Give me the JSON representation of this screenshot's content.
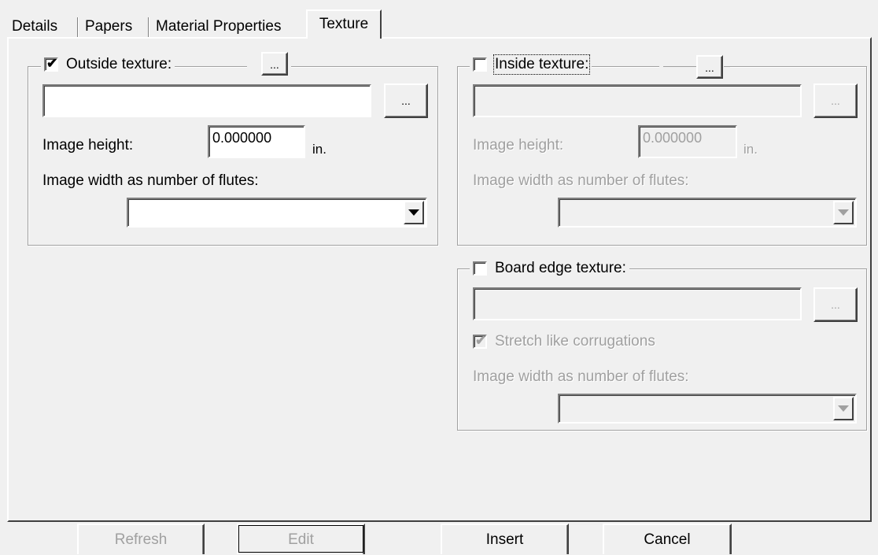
{
  "tabs": [
    {
      "label": "Details"
    },
    {
      "label": "Papers"
    },
    {
      "label": "Material Properties"
    },
    {
      "label": "Texture"
    }
  ],
  "outside": {
    "checkbox_label": "Outside texture:",
    "checked": true,
    "browse_label": "...",
    "header_button_label": "...",
    "path_value": "",
    "height_label": "Image height:",
    "height_value": "0.000000",
    "units": "in.",
    "width_label": "Image width as number of flutes:",
    "width_value": ""
  },
  "inside": {
    "checkbox_label": "Inside texture:",
    "checked": false,
    "browse_label": "...",
    "header_button_label": "...",
    "path_value": "",
    "height_label": "Image height:",
    "height_value": "0.000000",
    "units": "in.",
    "width_label": "Image width as number of flutes:",
    "width_value": ""
  },
  "board_edge": {
    "checkbox_label": "Board edge texture:",
    "checked": false,
    "browse_label": "...",
    "path_value": "",
    "stretch_label": "Stretch like corrugations",
    "stretch_checked": true,
    "width_label": "Image width as number of flutes:",
    "width_value": ""
  },
  "bottom_buttons": {
    "refresh": "Refresh",
    "edit": "Edit",
    "insert": "Insert",
    "cancel": "Cancel"
  }
}
